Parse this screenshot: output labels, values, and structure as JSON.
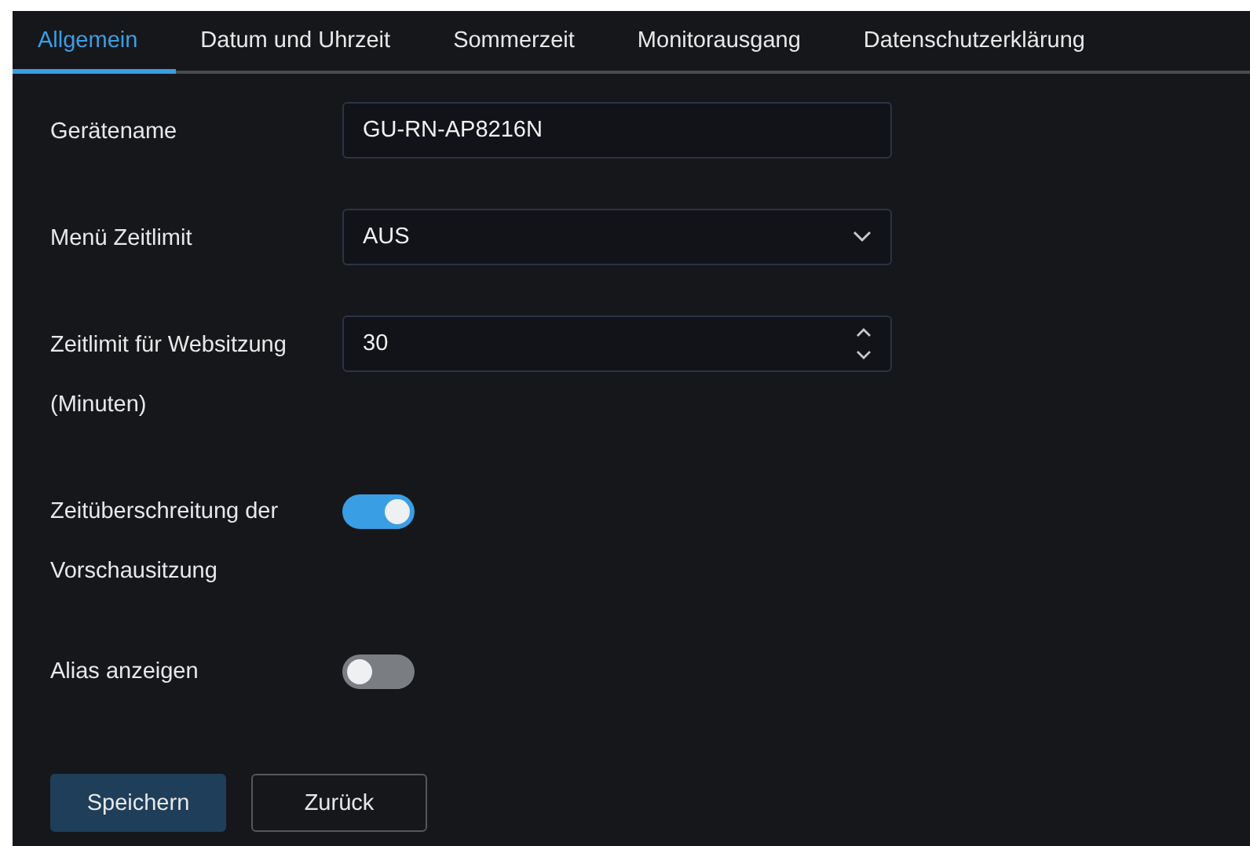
{
  "tabs": [
    {
      "label": "Allgemein",
      "selected": true
    },
    {
      "label": "Datum und Uhrzeit",
      "selected": false
    },
    {
      "label": "Sommerzeit",
      "selected": false
    },
    {
      "label": "Monitorausgang",
      "selected": false
    },
    {
      "label": "Datenschutzerklärung",
      "selected": false
    }
  ],
  "fields": [
    {
      "kind": "text",
      "label": "Gerätename",
      "value": "GU-RN-AP8216N"
    },
    {
      "kind": "select",
      "label": "Menü Zeitlimit",
      "value": "AUS"
    },
    {
      "kind": "number",
      "label": "Zeitlimit für Websitzung (Minuten)",
      "value": "30"
    },
    {
      "kind": "toggle",
      "label": "Zeitüberschreitung der Vorschausitzung",
      "on": true
    },
    {
      "kind": "toggle",
      "label": "Alias anzeigen",
      "on": false
    }
  ],
  "buttons": [
    {
      "label": "Speichern",
      "kind": "primary"
    },
    {
      "label": "Zurück",
      "kind": "secondary"
    }
  ]
}
